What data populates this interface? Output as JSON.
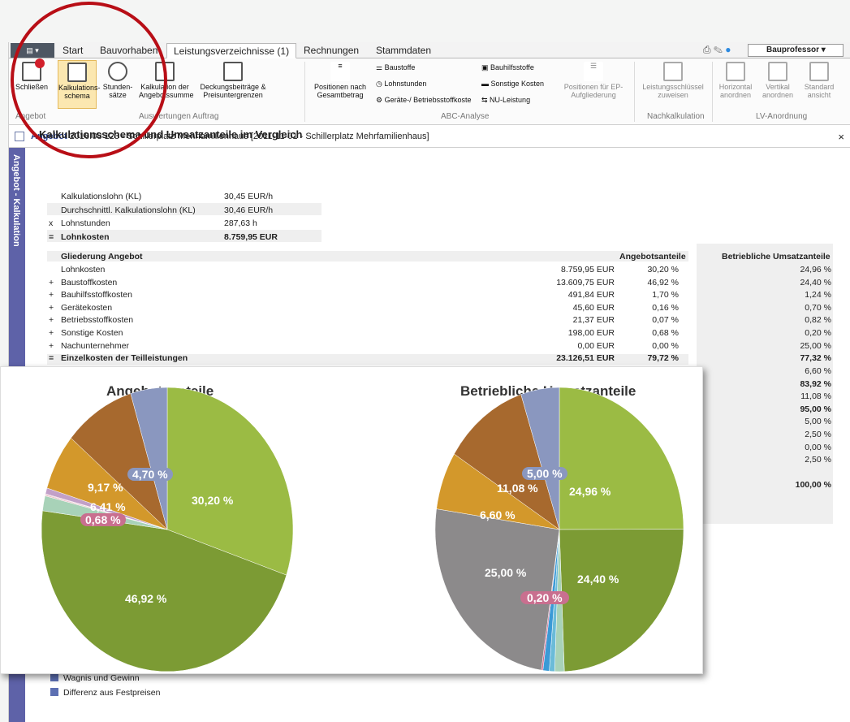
{
  "tabs": [
    "Start",
    "Bauvorhaben",
    "Leistungsverzeichnisse (1)",
    "Rechnungen",
    "Stammdaten"
  ],
  "profile": "Bauprofessor",
  "ribbon": {
    "close": "Schließen",
    "kalk": "Kalkulations-\nschema",
    "stunden": "Stunden-\nsätze",
    "kalk_summe": "Kalkulation der\nAngebotssumme",
    "deckung": "Deckungsbeiträge &\nPreisuntergrenzen",
    "positionen": "Positionen nach\nGesamtbetrag",
    "baustoffe": "Baustoffe",
    "lohnstunden": "Lohnstunden",
    "geraete": "Geräte-/ Betriebsstoffkoste",
    "bauhilfs": "Bauhilfsstoffe",
    "sonstige": "Sonstige Kosten",
    "nu": "NU-Leistung",
    "ep": "Positionen für EP-\nAufgliederung",
    "lschl": "Leistungsschlüssel\nzuweisen",
    "horiz": "Horizontal\nanordnen",
    "vert": "Vertikal\nanordnen",
    "std": "Standard\nansicht",
    "g1": "Angebot",
    "g2": "Auswertungen Auftrag",
    "g3": "ABC-Analyse",
    "g4": "Nachkalkulation",
    "g5": "LV-Anordnung"
  },
  "header": {
    "label": "Angebot",
    "text": "2016.08 123 - Schillerplatz Mehrfamilienhaus [2011-11-01 - Schillerplatz Mehrfamilienhaus]"
  },
  "side": "Angebot - Kalkulation",
  "title": "Kalkulationsschema und Umsatzanteile im Vergleich",
  "top_rows": [
    [
      "",
      "Kalkulationslohn (KL)",
      "30,45 EUR/h"
    ],
    [
      "",
      "Durchschnittl. Kalkulationslohn (KL)",
      "30,46 EUR/h"
    ],
    [
      "x",
      "Lohnstunden",
      "287,63 h"
    ],
    [
      "=",
      "Lohnkosten",
      "8.759,95 EUR"
    ]
  ],
  "table": {
    "h1": "Gliederung Angebot",
    "h2": "Angebotsanteile",
    "h3": "Betriebliche Umsatzanteile",
    "rows": [
      [
        "",
        "Lohnkosten",
        "8.759,95 EUR",
        "30,20 %",
        "24,96 %"
      ],
      [
        "+",
        "Baustoffkosten",
        "13.609,75 EUR",
        "46,92 %",
        "24,40 %"
      ],
      [
        "+",
        "Bauhilfsstoffkosten",
        "491,84 EUR",
        "1,70 %",
        "1,24 %"
      ],
      [
        "+",
        "Gerätekosten",
        "45,60 EUR",
        "0,16 %",
        "0,70 %"
      ],
      [
        "+",
        "Betriebsstoffkosten",
        "21,37 EUR",
        "0,07 %",
        "0,82 %"
      ],
      [
        "+",
        "Sonstige Kosten",
        "198,00 EUR",
        "0,68 %",
        "0,20 %"
      ],
      [
        "+",
        "Nachunternehmer",
        "0,00 EUR",
        "0,00 %",
        "25,00 %"
      ],
      [
        "=",
        "Einzelkosten der Teilleistungen",
        "23.126,51 EUR",
        "79,72 %",
        "77,32 %"
      ]
    ],
    "right_only": [
      "6,60 %",
      "83,92 %",
      "11,08 %",
      "95,00 %",
      "5,00 %",
      "2,50 %",
      "0,00 %",
      "2,50 %",
      "",
      "100,00 %"
    ]
  },
  "legend": [
    "Wagnis und Gewinn",
    "Differenz aus Festpreisen"
  ],
  "chart1": {
    "title": "Angebotsanteile",
    "labels": [
      "30,20 %",
      "46,92 %",
      "9,17 %",
      "6,41 %",
      "0,68 %",
      "4,70 %"
    ]
  },
  "chart2": {
    "title": "Betriebliche Umsatzanteile",
    "labels": [
      "24,96 %",
      "24,40 %",
      "25,00 %",
      "6,60 %",
      "11,08 %",
      "5,00 %",
      "0,20 %"
    ]
  },
  "chart_data": [
    {
      "type": "pie",
      "title": "Angebotsanteile",
      "values": [
        30.2,
        46.92,
        1.7,
        0.16,
        0.07,
        0.68,
        6.41,
        9.17,
        4.7
      ],
      "colors": [
        "#9bbb44",
        "#7c9b34",
        "#a8d2b8",
        "#e9c0c8",
        "#d06d92",
        "#c2a0c8",
        "#d3982b",
        "#a7692e",
        "#8a97bf"
      ]
    },
    {
      "type": "pie",
      "title": "Betriebliche Umsatzanteile",
      "values": [
        24.96,
        24.4,
        1.24,
        0.7,
        0.82,
        0.2,
        25.0,
        6.6,
        11.08,
        5.0
      ],
      "colors": [
        "#9bbb44",
        "#7c9b34",
        "#a8d2b8",
        "#6bbbd8",
        "#3b9ad6",
        "#d06d92",
        "#8c8a8b",
        "#d3982b",
        "#a7692e",
        "#8a97bf"
      ]
    }
  ]
}
